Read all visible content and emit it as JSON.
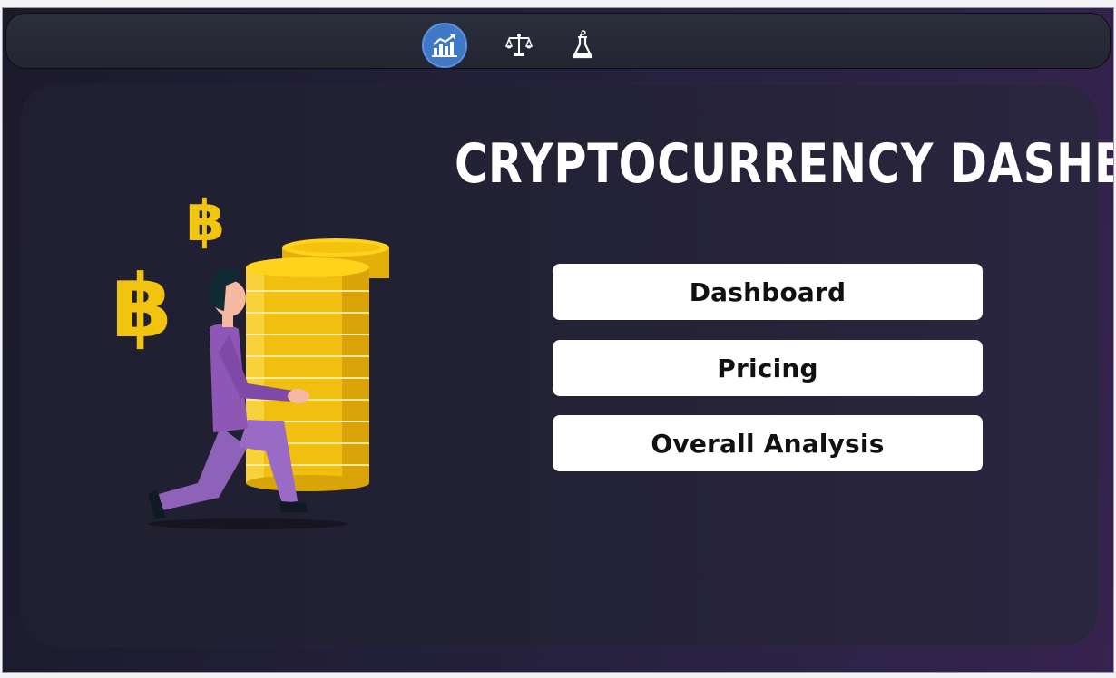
{
  "nav": {
    "items": [
      {
        "icon": "chart-growth-icon",
        "active": true
      },
      {
        "icon": "scales-icon",
        "active": false
      },
      {
        "icon": "flask-icon",
        "active": false
      }
    ]
  },
  "main": {
    "title": "CRYPTOCURRENCY  DASHBOARD",
    "buttons": {
      "dashboard": "Dashboard",
      "pricing": "Pricing",
      "analysis": "Overall Analysis"
    },
    "illustration": {
      "coin_symbol": "฿",
      "accent_gold": "#f1c40f",
      "figure_shirt": "#8e57b5"
    }
  },
  "colors": {
    "active_nav": "#3f78c6",
    "background_start": "#1b1a2a",
    "background_end": "#38224f",
    "button_bg": "#ffffff"
  }
}
